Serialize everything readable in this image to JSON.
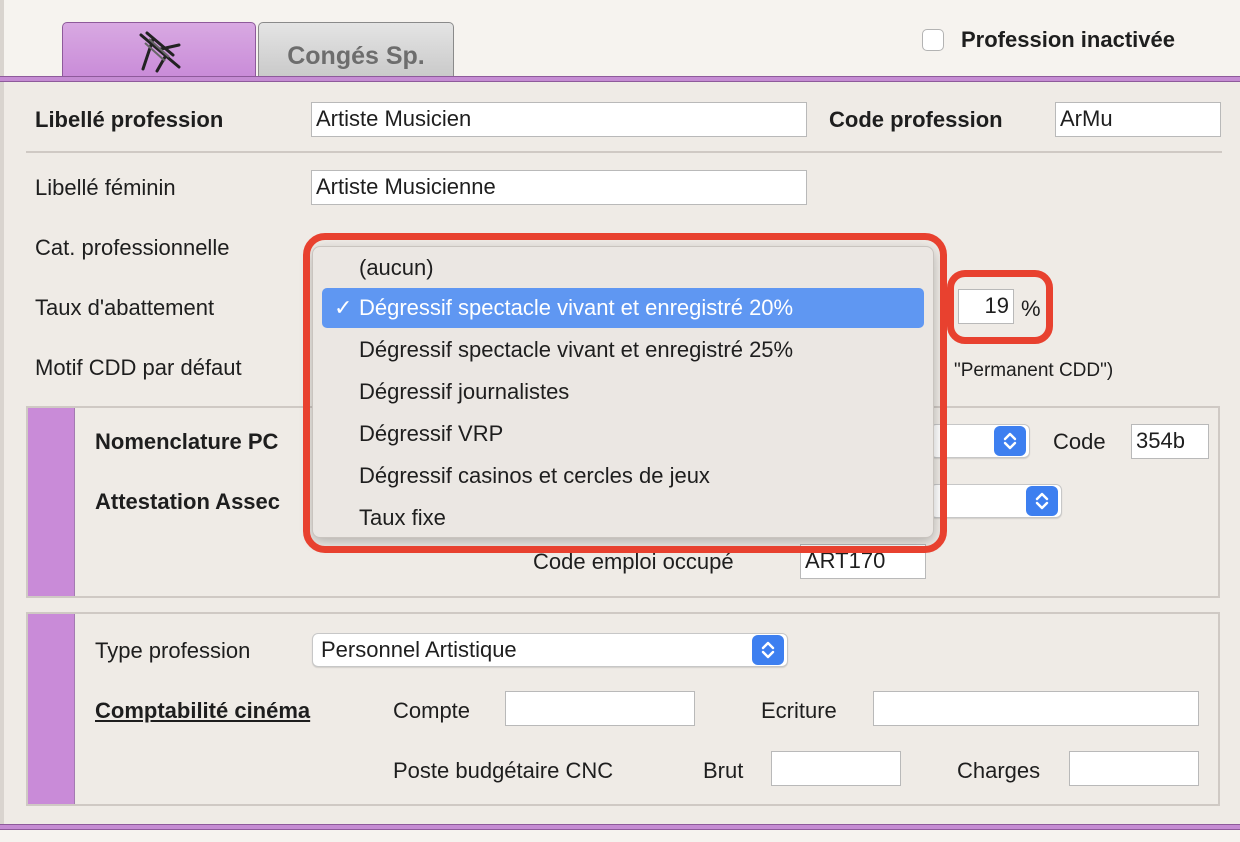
{
  "tabs": [
    {
      "label": "",
      "icon": "beach-chair-icon",
      "active": true
    },
    {
      "label": "Congés Sp.",
      "active": false
    }
  ],
  "profession_inactive": {
    "label": "Profession inactivée",
    "checked": false
  },
  "fields": {
    "libelle_profession": {
      "label": "Libellé profession",
      "value": "Artiste Musicien"
    },
    "code_profession": {
      "label": "Code profession",
      "value": "ArMu"
    },
    "libelle_feminin": {
      "label": "Libellé féminin",
      "value": "Artiste Musicienne"
    },
    "cat_professionnelle": {
      "label": "Cat. professionnelle"
    },
    "taux_abattement": {
      "label": "Taux d'abattement",
      "value": "19",
      "unit": "%"
    },
    "motif_cdd": {
      "label": "Motif CDD par défaut",
      "hint": "\"Permanent CDD\")"
    }
  },
  "panel1": {
    "nomenclature_label": "Nomenclature PC",
    "attestation_label": "Attestation Assec",
    "code_label": "Code",
    "code_value": "354b",
    "code_emploi_label": "Code emploi occupé",
    "code_emploi_value": "ART170"
  },
  "panel2": {
    "type_profession_label": "Type profession",
    "type_profession_value": "Personnel Artistique",
    "comptabilite_label": "Comptabilité cinéma",
    "compte_label": "Compte",
    "ecriture_label": "Ecriture",
    "poste_label": "Poste budgétaire CNC",
    "brut_label": "Brut",
    "charges_label": "Charges"
  },
  "dropdown": {
    "items": [
      "(aucun)",
      "Dégressif spectacle vivant et enregistré 20%",
      "Dégressif spectacle vivant et enregistré 25%",
      "Dégressif journalistes",
      "Dégressif VRP",
      "Dégressif casinos et cercles de jeux",
      "Taux fixe"
    ],
    "selected_index": 1,
    "check_mark": "✓"
  },
  "colors": {
    "accent_purple": "#c98bd8",
    "highlight_blue": "#5f97f2",
    "callout_red": "#e8412f"
  }
}
